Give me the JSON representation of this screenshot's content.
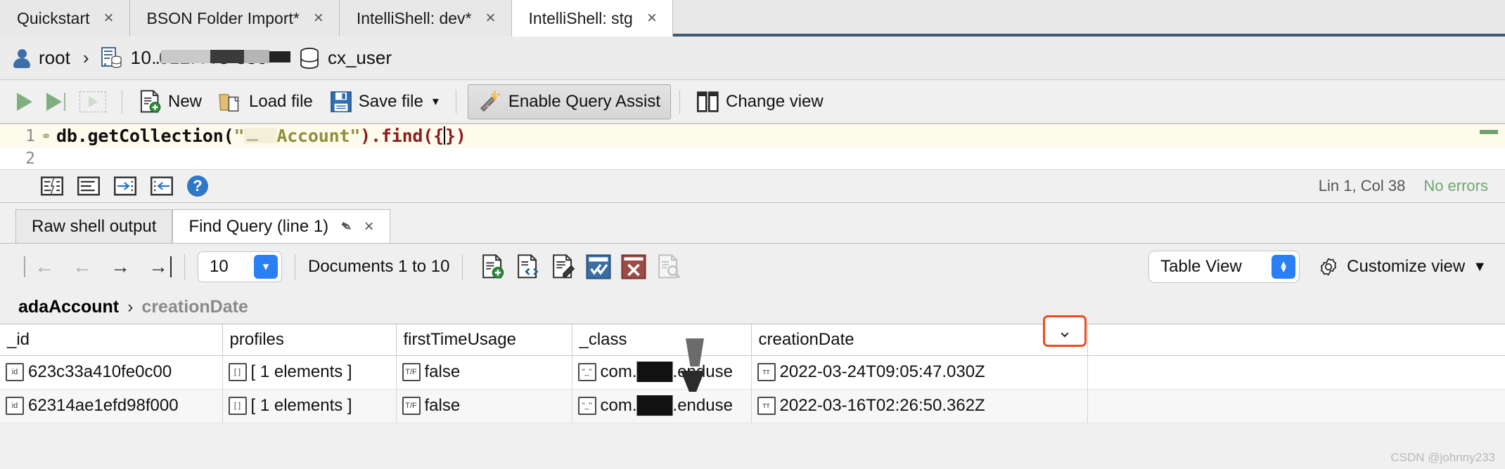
{
  "tabs": [
    {
      "label": "Quickstart",
      "close": "×",
      "active": false
    },
    {
      "label": "BSON Folder Import*",
      "close": "×",
      "active": false
    },
    {
      "label": "IntelliShell: dev*",
      "close": "×",
      "active": false
    },
    {
      "label": "IntelliShell: stg",
      "close": "×",
      "active": true
    }
  ],
  "breadcrumb": {
    "user": "root",
    "sep": "›",
    "host": "10..███████386",
    "database": "cx_user"
  },
  "toolbar": {
    "run_label": "run-query",
    "run_selected_label": "run-selection",
    "stop_label": "stop",
    "new_label": "New",
    "load_label": "Load file",
    "save_label": "Save file",
    "save_caret": "▾",
    "query_assist_label": "Enable Query Assist",
    "change_view_label": "Change view"
  },
  "editor": {
    "lines": [
      "1",
      "2"
    ],
    "code": {
      "prefix": "db.getCollection(",
      "quote_open": "\"",
      "redacted": "██",
      "collection": "Account",
      "quote_close": "\"",
      "mid": ").find(",
      "brace_open": "{",
      "brace_close": "}",
      "paren_close": ")"
    },
    "status": {
      "position": "Lin 1, Col 38",
      "errors": "No errors",
      "icons": [
        "format-code-icon",
        "align-left-icon",
        "indent-right-icon",
        "indent-left-icon",
        "help-icon"
      ]
    }
  },
  "result_tabs": [
    {
      "label": "Raw shell output",
      "active": false
    },
    {
      "label": "Find Query (line 1)",
      "active": true,
      "pin": "✒",
      "close": "×"
    }
  ],
  "pager": {
    "first": "←",
    "prev": "←",
    "next": "→",
    "last": "→",
    "page_size": "10",
    "page_size_caret": "▾",
    "documents_label": "Documents 1 to 10",
    "actions": [
      "add-document-icon",
      "view-json-icon",
      "edit-document-icon",
      "apply-changes-icon",
      "cancel-changes-icon",
      "find-document-icon"
    ],
    "view_mode": "Table View",
    "customize_label": "Customize view",
    "customize_caret": "▼"
  },
  "result_breadcrumb": {
    "collection": "adaAccount",
    "sep": "›",
    "field": "creationDate"
  },
  "table": {
    "columns": [
      "_id",
      "profiles",
      "firstTimeUsage",
      "_class",
      "creationDate",
      ""
    ],
    "header_caret": "⌄",
    "rows": [
      {
        "_id": "623c33a410fe0c00",
        "_id_type": "id",
        "profiles": "[ 1 elements ]",
        "profiles_type": "[ ]",
        "firstTimeUsage": "false",
        "firstTimeUsage_type": "T/F",
        "_class": "com.███.enduse",
        "_class_type": "\"_\"",
        "creationDate": "2022-03-24T09:05:47.030Z",
        "creationDate_type": "ᴛᴛ"
      },
      {
        "_id": "62314ae1efd98f000",
        "_id_type": "id",
        "profiles": "[ 1 elements ]",
        "profiles_type": "[ ]",
        "firstTimeUsage": "false",
        "firstTimeUsage_type": "T/F",
        "_class": "com.███.enduse",
        "_class_type": "\"_\"",
        "creationDate": "2022-03-16T02:26:50.362Z",
        "creationDate_type": "ᴛᴛ"
      }
    ]
  },
  "watermark": "CSDN @johnny233",
  "colors": {
    "accent_blue": "#2b7ff5",
    "tab_underline": "#3d5a73",
    "highlight_red": "#ef4a21",
    "no_errors_green": "#6fa86f",
    "code_string": "#8f8f3c",
    "code_paren": "#8b1d1d"
  }
}
